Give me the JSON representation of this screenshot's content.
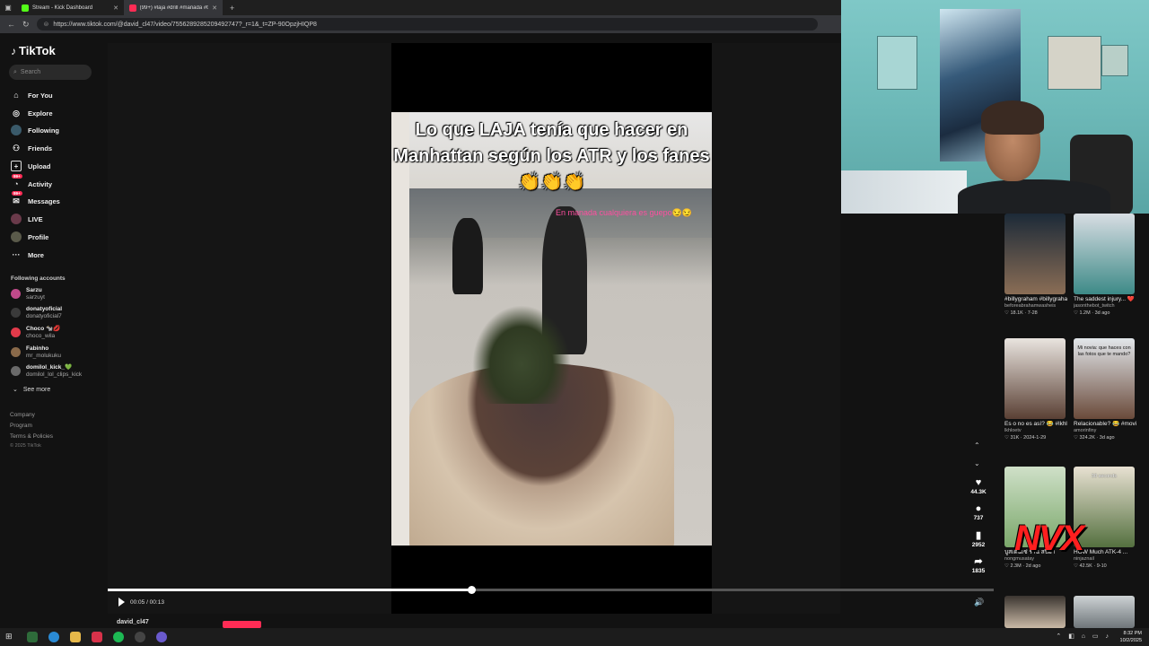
{
  "browser": {
    "tabs": [
      {
        "label": "Stream - Kick Dashboard",
        "color": "#53fc18"
      },
      {
        "label": "(99+) #laja #drill #manada #tesie",
        "color": "#fe2c55"
      }
    ],
    "url": "https://www.tiktok.com/@david_cl47/video/7556289285209492747?_r=1&_t=ZP-90OpzjHIQP8"
  },
  "sidebar": {
    "logo": "TikTok",
    "search_placeholder": "Search",
    "nav": [
      {
        "label": "For You",
        "icon": "home-icon"
      },
      {
        "label": "Explore",
        "icon": "compass-icon"
      },
      {
        "label": "Following",
        "icon": "following-icon"
      },
      {
        "label": "Friends",
        "icon": "friends-icon"
      },
      {
        "label": "Upload",
        "icon": "upload-icon"
      },
      {
        "label": "Activity",
        "icon": "activity-icon",
        "badge": "99+"
      },
      {
        "label": "Messages",
        "icon": "messages-icon",
        "badge": "99+"
      },
      {
        "label": "LIVE",
        "icon": "live-icon"
      },
      {
        "label": "Profile",
        "icon": "profile-icon"
      },
      {
        "label": "More",
        "icon": "more-icon"
      }
    ],
    "following_title": "Following accounts",
    "accounts": [
      {
        "name": "Sarzu",
        "handle": "sarzuyt"
      },
      {
        "name": "donatyoficial",
        "handle": "donatyoficial7"
      },
      {
        "name": "Choco 🐄💋",
        "handle": "choco_wila"
      },
      {
        "name": "Fabinho",
        "handle": "mr_molukuku"
      },
      {
        "name": "domilol_kick_💚",
        "handle": "domilol_lol_clips_kick"
      }
    ],
    "see_more": "See more",
    "footer": [
      "Company",
      "Program",
      "Terms & Policies",
      "© 2025 TikTok"
    ]
  },
  "video": {
    "caption": "Lo que LAJA tenía que hacer en  Manhattan según los ATR y los fanes 👏👏👏",
    "overlay": "En manada cualquiera es guepo😏😏",
    "time": "00:05 / 00:13",
    "progress": 0.41,
    "author": "david_cl47"
  },
  "actions": {
    "likes": "44.3K",
    "comments": "737",
    "saves": "2952",
    "shares": "1835"
  },
  "recommended": [
    {
      "title": "#billygraham #billygrahamsermo...",
      "author": "beforeabrahamwasheis",
      "stats": "♡ 18.1K · 7-28",
      "colors": [
        "#1c2a38",
        "#8a6d55"
      ],
      "overlay": ""
    },
    {
      "title": "The saddest injury... ❤️",
      "author": "jasonthebot_twitch",
      "stats": "♡ 1.2M · 3d ago",
      "colors": [
        "#d8dde3",
        "#3d8a87"
      ],
      "overlay": ""
    },
    {
      "title": "Es o no es así? 😂 #lkhloetv #viral #fyp",
      "author": "lkhloetv",
      "stats": "♡ 31K · 2024-1-29",
      "colors": [
        "#e9e4df",
        "#5a4034"
      ],
      "overlay": ""
    },
    {
      "title": "Relacionable? 😂 #movios #novias...",
      "author": "amorinfiny",
      "stats": "♡ 324.2K · 3d ago",
      "colors": [
        "#e2e6ea",
        "#6a4a3a"
      ],
      "overlay": "Mi novia: que haces con las fotos que te mando?"
    },
    {
      "title": "บูสเดนเซ่ ร้าน สปีอา",
      "author": "nongmusatay",
      "stats": "♡ 2.3M · 2d ago",
      "colors": [
        "#cfe0c8",
        "#7aa76a"
      ],
      "overlay": ""
    },
    {
      "title": "HOW Much ATK-4 ...",
      "author": "ninjaznail",
      "stats": "♡ 42.5K · 9-10",
      "colors": [
        "#e8e1d2",
        "#54703f"
      ],
      "overlay": "30 seconds"
    }
  ],
  "watermark": "NVX",
  "taskbar": {
    "time": "8:32 PM",
    "date": "10/2/2025"
  }
}
